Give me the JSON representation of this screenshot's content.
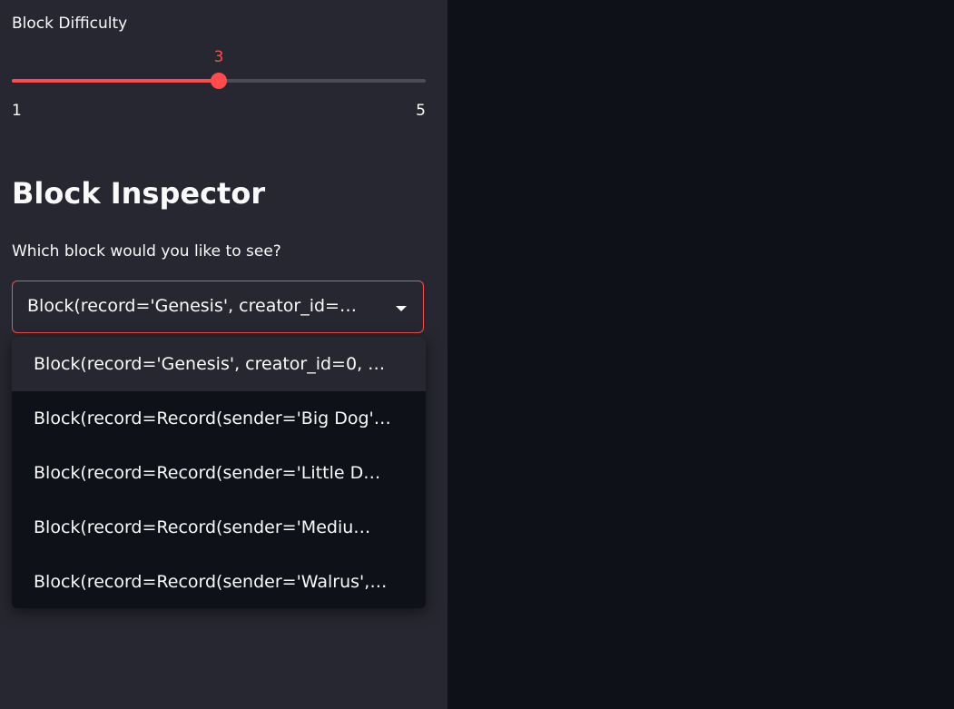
{
  "sidebar": {
    "slider": {
      "label": "Block Difficulty",
      "value": "3",
      "min": "1",
      "max": "5",
      "fill_fraction": 0.5
    },
    "heading": "Block Inspector",
    "select": {
      "label": "Which block would you like to see?",
      "selected": "Block(record='Genesis', creator_id=…",
      "options": [
        "Block(record='Genesis', creator_id=0, …",
        "Block(record=Record(sender='Big Dog'…",
        "Block(record=Record(sender='Little D…",
        "Block(record=Record(sender='Mediu…",
        "Block(record=Record(sender='Walrus',…"
      ]
    }
  },
  "colors": {
    "accent": "#ff4b4b",
    "sidebar_bg": "#262730",
    "main_bg": "#0e1117",
    "text": "#fafafa"
  },
  "icons": {
    "select_chevron": "chevron-down-icon"
  }
}
